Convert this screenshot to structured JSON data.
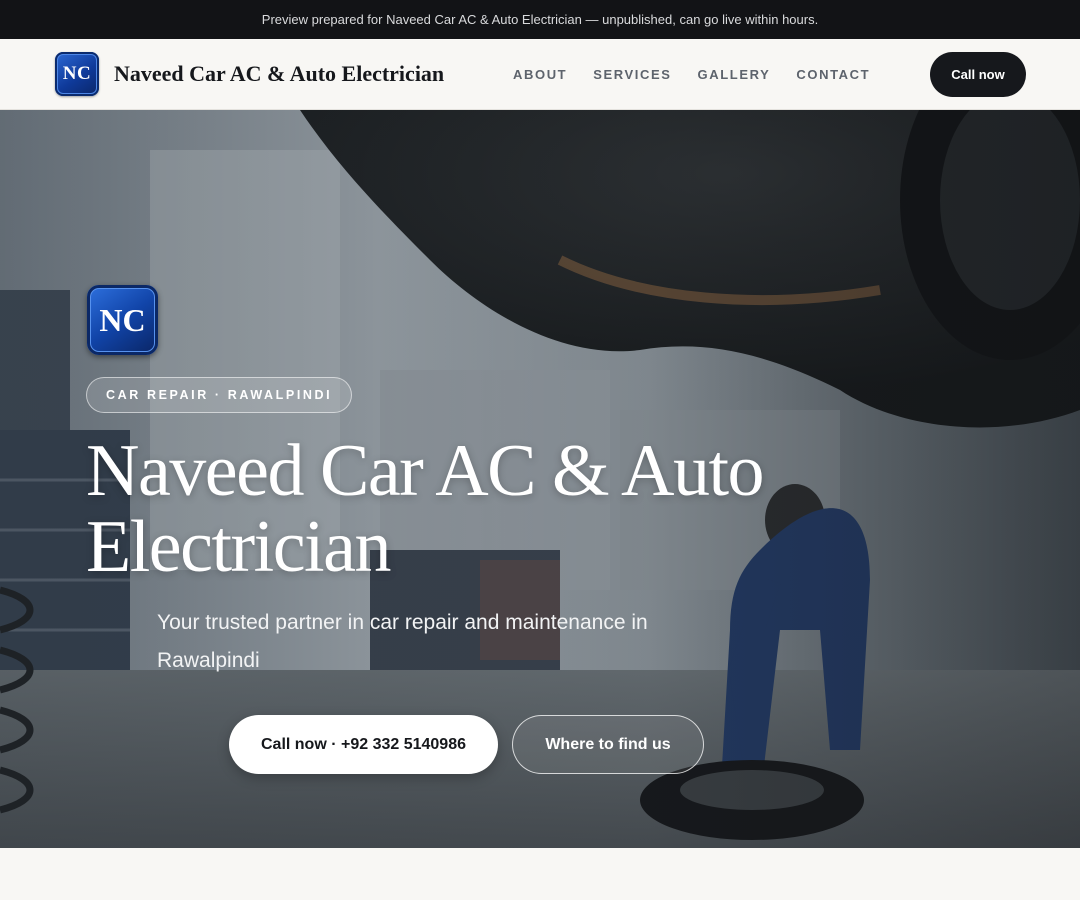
{
  "preview_banner": {
    "text": "Preview prepared for Naveed Car AC & Auto Electrician — unpublished, can go live within hours."
  },
  "header": {
    "logo_text": "NC",
    "brand_name": "Naveed Car AC & Auto Electrician",
    "nav": [
      "ABOUT",
      "SERVICES",
      "GALLERY",
      "CONTACT"
    ],
    "cta_label": "Call now"
  },
  "hero": {
    "logo_text": "NC",
    "tag": "CAR REPAIR · RAWALPINDI",
    "title": "Naveed Car AC & Auto Electrician",
    "subtitle": "Your trusted partner in car repair and maintenance in Rawalpindi",
    "primary_button": "Call now · +92 332 5140986",
    "secondary_button": "Where to find us",
    "background_image": "mechanic-under-lifted-car-photo"
  },
  "colors": {
    "banner_bg": "#121316",
    "header_bg": "#f8f7f4",
    "dark_button": "#16181c",
    "logo_blue": "#1144a8",
    "nav_text": "#5d636c"
  }
}
